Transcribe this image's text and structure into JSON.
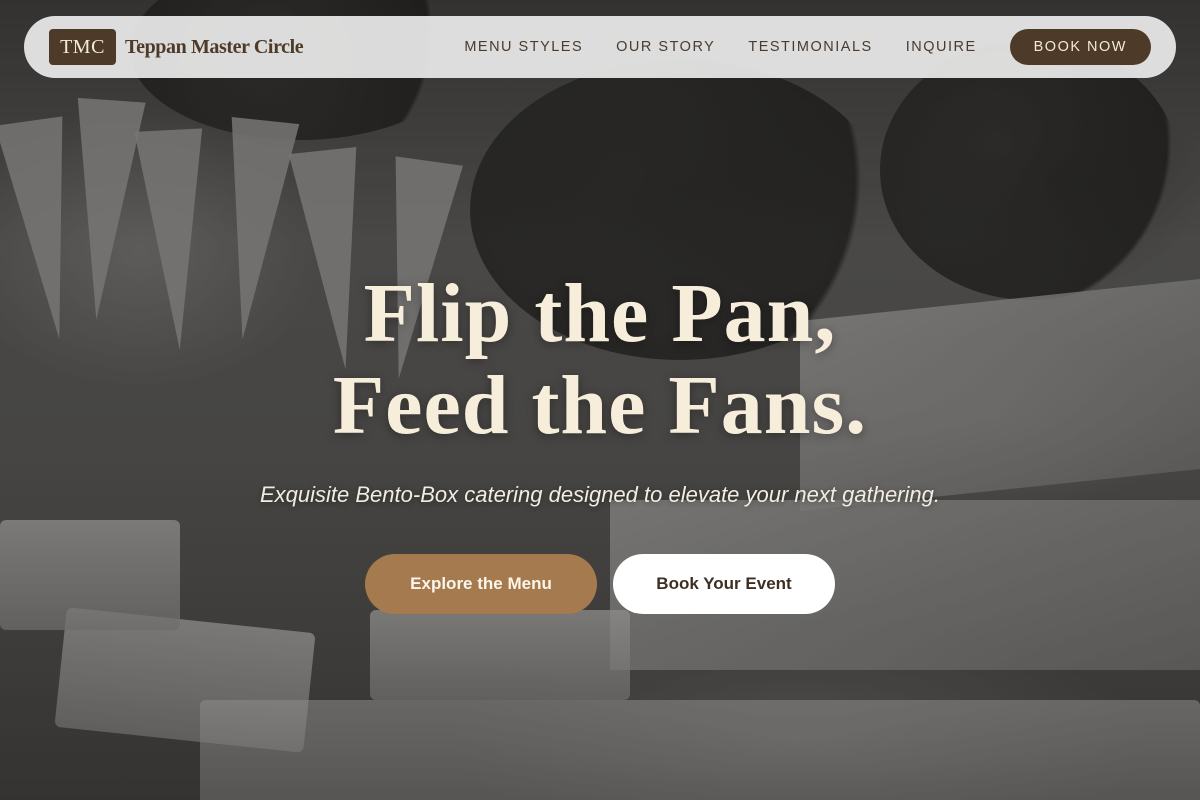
{
  "brand": {
    "logo_text": "TMC",
    "name": "Teppan Master Circle"
  },
  "nav": {
    "links": [
      {
        "label": "MENU STYLES"
      },
      {
        "label": "OUR STORY"
      },
      {
        "label": "TESTIMONIALS"
      },
      {
        "label": "INQUIRE"
      }
    ],
    "cta_label": "BOOK NOW"
  },
  "hero": {
    "title_line1": "Flip the Pan,",
    "title_line2": "Feed the Fans.",
    "subtitle": "Exquisite Bento-Box catering designed to elevate your next gathering.",
    "primary_button": "Explore the Menu",
    "secondary_button": "Book Your Event",
    "background": "grayscale outdoor catering table with paper cones, snack trays and flowers"
  },
  "colors": {
    "brand_brown": "#4e3a28",
    "accent_tan": "#a57a4e",
    "cream_text": "#f6eedb",
    "nav_bg": "#ececec"
  }
}
